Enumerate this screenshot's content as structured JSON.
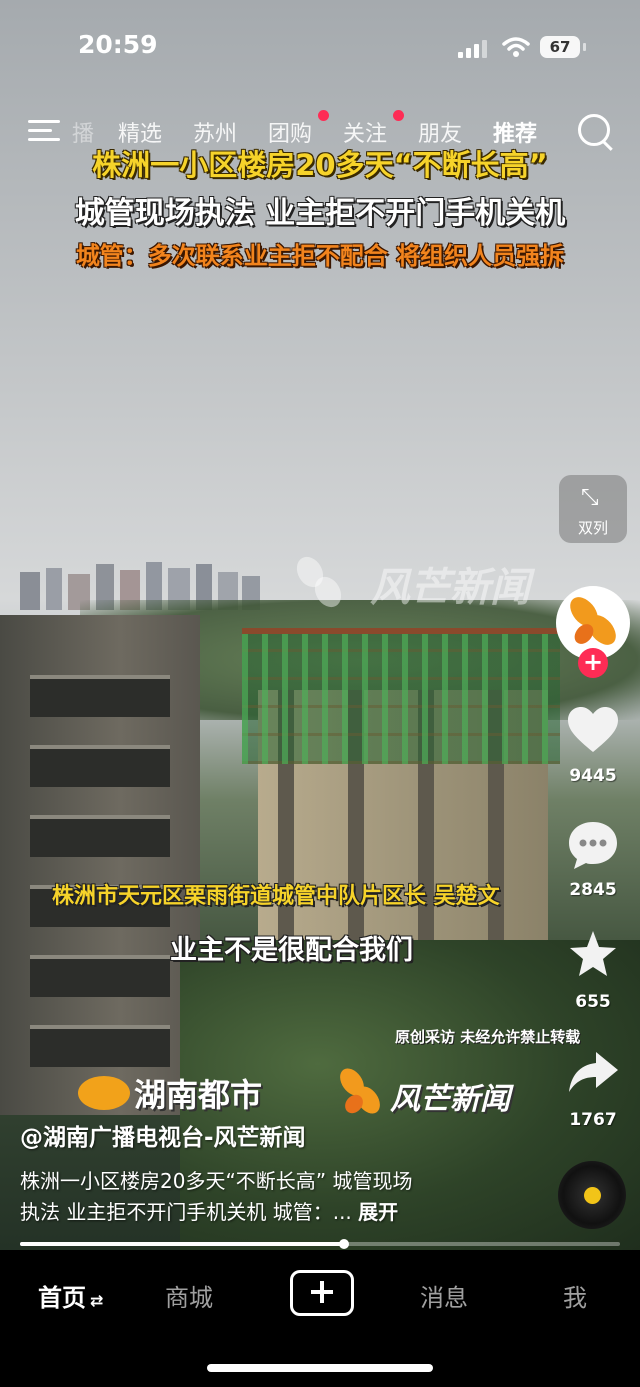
{
  "status_bar": {
    "time": "20:59",
    "battery": "67"
  },
  "top_nav": {
    "partial_tab": "播",
    "tabs": [
      "精选",
      "苏州",
      "团购",
      "关注",
      "朋友",
      "推荐"
    ],
    "active_tab": "推荐"
  },
  "video": {
    "headline_1": "株洲一小区楼房20多天“不断长高”",
    "headline_2": "城管现场执法 业主拒不开门手机关机",
    "headline_3": "城管：多次联系业主拒不配合 将组织人员强拆",
    "watermark": "风芒新闻",
    "speaker_caption": "株洲市天元区栗雨街道城管中队片区长  吴楚文",
    "speech_caption": "业主不是很配合我们",
    "copyright_notice": "原创采访 未经允许禁止转载",
    "brand_left": "湖南都市",
    "brand_right": "风芒新闻"
  },
  "right_rail": {
    "layout_toggle_label": "双列",
    "likes": "9445",
    "comments": "2845",
    "favorites": "655",
    "shares": "1767"
  },
  "post": {
    "author": "@湖南广播电视台-风芒新闻",
    "description_line1": "株洲一小区楼房20多天“不断长高” 城管现场",
    "description_line2": "执法 业主拒不开门手机关机 城管：... ",
    "expand_label": "展开",
    "progress_fraction": 0.54
  },
  "bottom_nav": {
    "home": "首页",
    "mall": "商城",
    "messages": "消息",
    "me": "我"
  },
  "colors": {
    "accent_red": "#fe2c55",
    "headline_yellow": "#f6d32a",
    "headline_orange": "#f2841d"
  },
  "icons": [
    "menu-icon",
    "search-icon",
    "collapse-arrows-icon",
    "heart-icon",
    "comment-icon",
    "star-icon",
    "share-icon",
    "music-disc-icon",
    "plus-icon"
  ]
}
